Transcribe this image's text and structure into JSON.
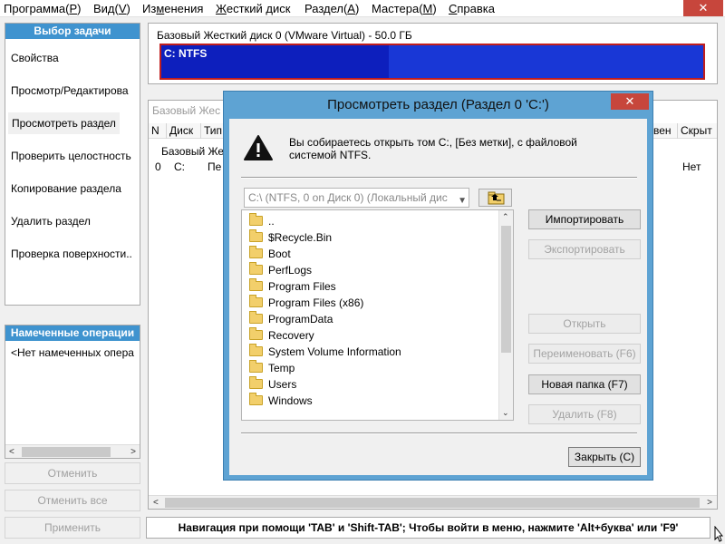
{
  "menu": [
    {
      "text": "Программа(",
      "key": "Р",
      "tail": ")"
    },
    {
      "text": "Вид(",
      "key": "V",
      "tail": ")"
    },
    {
      "text": "Из",
      "key": "м",
      "tail": "енения"
    },
    {
      "text": "",
      "key": "Ж",
      "tail": "есткий диск"
    },
    {
      "text": "Раздел(",
      "key": "А",
      "tail": ")"
    },
    {
      "text": "Мастера(",
      "key": "М",
      "tail": ")"
    },
    {
      "text": "",
      "key": "С",
      "tail": "правка"
    }
  ],
  "window_close": "✕",
  "tasks": {
    "header": "Выбор задачи",
    "items": [
      "Свойства",
      "Просмотр/Редактирова",
      "Просмотреть раздел",
      "Проверить целостность",
      "Копирование раздела",
      "Удалить раздел",
      "Проверка поверхности.."
    ]
  },
  "pending": {
    "header": "Намеченные операции",
    "empty": "<Нет намеченных опера"
  },
  "left_buttons": {
    "undo": "Отменить",
    "undo_all": "Отменить все",
    "apply": "Применить"
  },
  "disk": {
    "title": "Базовый Жесткий диск 0 (VMware Virtual) - 50.0 ГБ",
    "partition_label": "C: NTFS",
    "used_fraction": 0.42
  },
  "background_table": {
    "crumb": "Базовый Жес",
    "columns": [
      "N",
      "Диск",
      "Тип",
      "вен",
      "Скрыт"
    ],
    "group_row": "Базовый Же",
    "row": [
      "0",
      "C:",
      "Пе",
      "Нет"
    ]
  },
  "status": "Навигация при помощи 'TAB' и 'Shift-TAB'; Чтобы войти в меню, нажмите 'Alt+буква' или 'F9'",
  "dialog": {
    "title": "Просмотреть раздел (Раздел 0 'C:')",
    "close": "✕",
    "message": "Вы собираетесь открыть том C:, [Без метки], с файловой системой NTFS.",
    "path": "C:\\ (NTFS, 0 on Диск 0) (Локальный дис",
    "files": [
      {
        "name": "..",
        "icon": "folder-icon"
      },
      {
        "name": "$Recycle.Bin",
        "icon": "folder-icon"
      },
      {
        "name": "Boot",
        "icon": "folder-icon"
      },
      {
        "name": "PerfLogs",
        "icon": "folder-icon"
      },
      {
        "name": "Program Files",
        "icon": "folder-icon"
      },
      {
        "name": "Program Files (x86)",
        "icon": "folder-icon"
      },
      {
        "name": "ProgramData",
        "icon": "folder-icon"
      },
      {
        "name": "Recovery",
        "icon": "folder-icon"
      },
      {
        "name": "System Volume Information",
        "icon": "folder-icon"
      },
      {
        "name": "Temp",
        "icon": "folder-icon"
      },
      {
        "name": "Users",
        "icon": "folder-icon"
      },
      {
        "name": "Windows",
        "icon": "folder-icon"
      }
    ],
    "buttons": {
      "import": "Импортировать",
      "export": "Экспортировать",
      "open": "Открыть",
      "rename": "Переименовать (F6)",
      "new_folder": "Новая папка (F7)",
      "delete": "Удалить (F8)",
      "close": "Закрыть (С)"
    }
  },
  "colors": {
    "accent": "#3f93cf",
    "disk_fill": "#1937d6",
    "disk_border": "#c01e1e",
    "close_red": "#c7463c"
  }
}
